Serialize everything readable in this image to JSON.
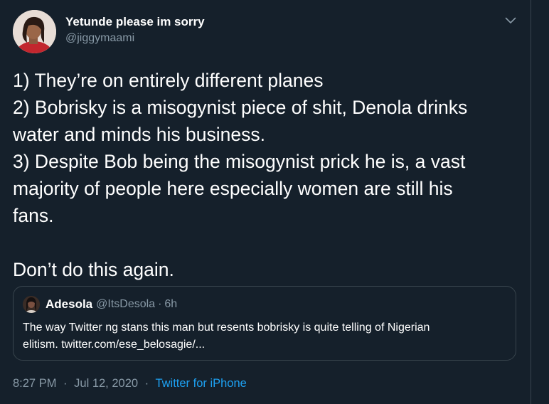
{
  "author": {
    "display_name": "Yetunde please im sorry",
    "handle": "@jiggymaami"
  },
  "tweet": {
    "lines": [
      "1) They’re on entirely different planes",
      "2) Bobrisky is a misogynist piece of shit, Denola drinks",
      "water and minds his business.",
      "3) Despite Bob being the misogynist prick he is, a vast",
      "majority of people here especially women are still his",
      "fans.",
      "",
      "Don’t do this again."
    ]
  },
  "quoted_tweet": {
    "display_name": "Adesola",
    "handle": "@ItsDesola",
    "separator": "·",
    "time": "6h",
    "lines": [
      "The way Twitter ng stans this man but resents bobrisky is quite telling of Nigerian",
      "elitism. twitter.com/ese_belosagie/..."
    ]
  },
  "meta": {
    "time": "8:27 PM",
    "separator": "·",
    "date": "Jul 12, 2020",
    "source": "Twitter for iPhone"
  },
  "icons": {
    "caret": "chevron-down-icon"
  },
  "colors": {
    "background": "#15202b",
    "secondary_text": "#8899a6",
    "link": "#1da1f2",
    "border": "#38444d"
  }
}
